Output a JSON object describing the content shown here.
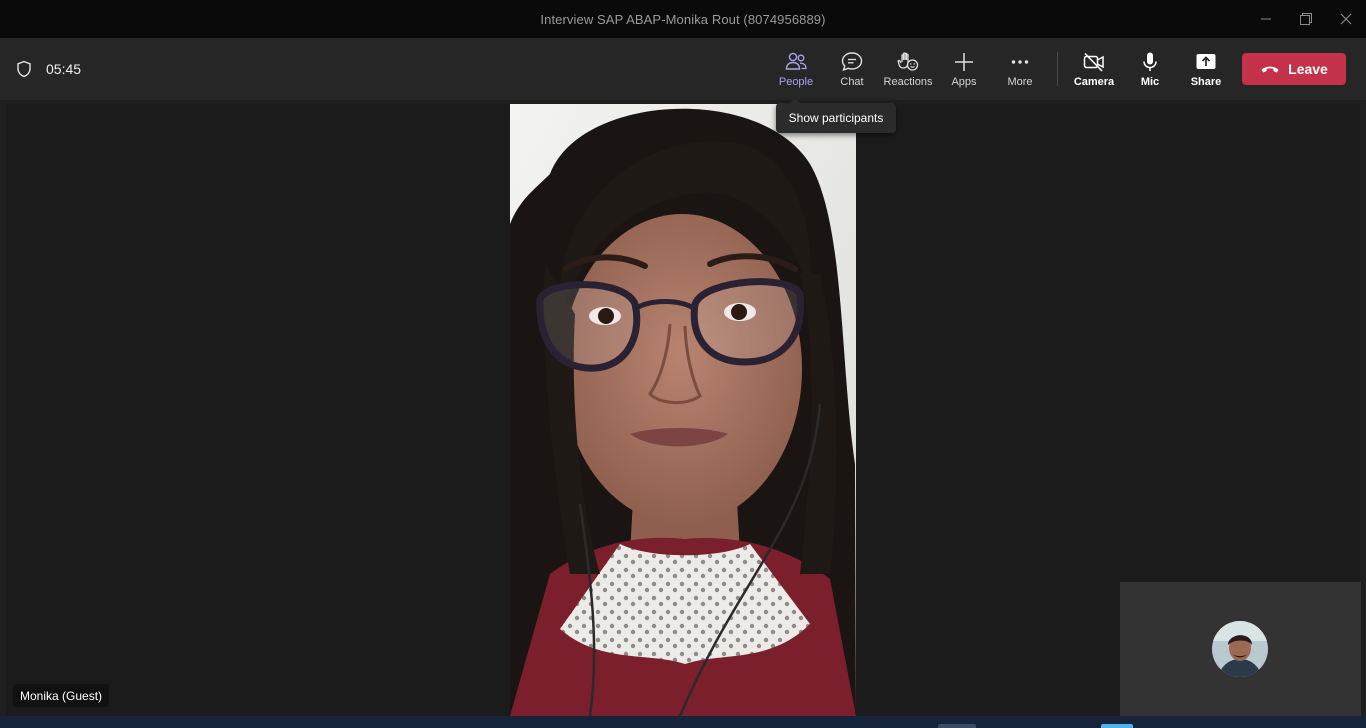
{
  "window": {
    "title": "Interview SAP ABAP-Monika Rout (8074956889)",
    "controls": [
      {
        "name": "minimize-button",
        "icon": "minimize-icon"
      },
      {
        "name": "maximize-button",
        "icon": "restore-icon"
      },
      {
        "name": "close-button",
        "icon": "close-icon"
      }
    ]
  },
  "meeting": {
    "timer": "05:45",
    "shield_icon": "shield-icon"
  },
  "toolbar": {
    "tools": [
      {
        "label": "People",
        "icon": "people-icon",
        "active": true
      },
      {
        "label": "Chat",
        "icon": "chat-icon"
      },
      {
        "label": "Reactions",
        "icon": "raise-hand-icon"
      },
      {
        "label": "Apps",
        "icon": "plus-icon"
      },
      {
        "label": "More",
        "icon": "more-icon"
      }
    ],
    "media": [
      {
        "label": "Camera",
        "icon": "camera-off-icon"
      },
      {
        "label": "Mic",
        "icon": "mic-icon"
      },
      {
        "label": "Share",
        "icon": "share-icon"
      }
    ],
    "leave_label": "Leave",
    "leave_color": "#c4314b"
  },
  "tooltip": {
    "text": "Show participants"
  },
  "video": {
    "participant_name": "Monika (Guest)"
  },
  "colors": {
    "accent": "#a9a3ee",
    "background": "#1f1f1f",
    "toolbar": "#262626"
  }
}
